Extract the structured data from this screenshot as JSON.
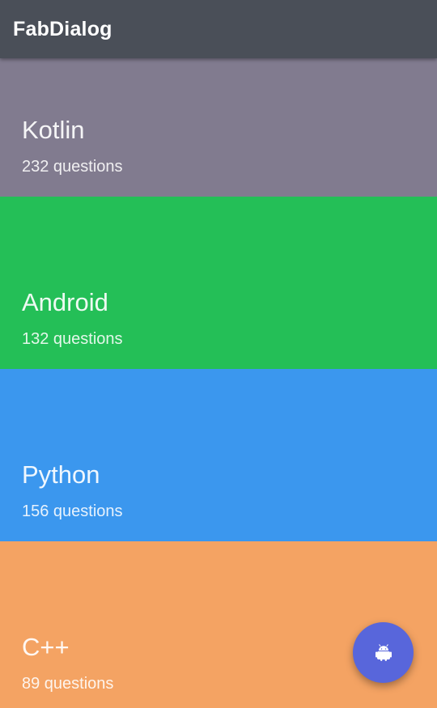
{
  "app_bar": {
    "title": "FabDialog",
    "background": "#4a4f58"
  },
  "topics": [
    {
      "name": "Kotlin",
      "count": "232 questions",
      "color": "#817b8f"
    },
    {
      "name": "Android",
      "count": "132 questions",
      "color": "#24bf57"
    },
    {
      "name": "Python",
      "count": "156 questions",
      "color": "#3b97ee"
    },
    {
      "name": "C++",
      "count": "89 questions",
      "color": "#f4a363"
    }
  ],
  "fab": {
    "icon": "android-icon",
    "color": "#5866db"
  }
}
